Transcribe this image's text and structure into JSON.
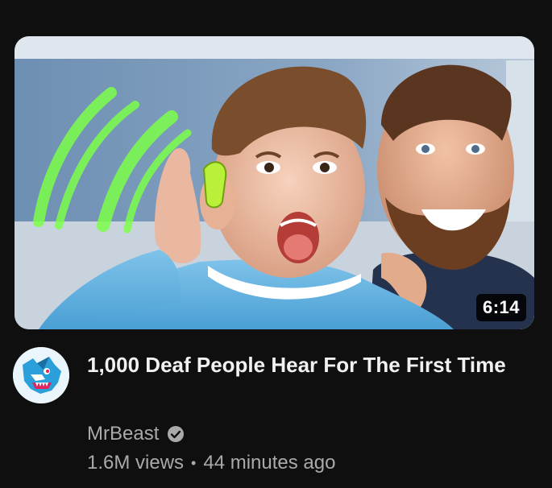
{
  "video": {
    "title": "1,000 Deaf People Hear For The First Time",
    "duration": "6:14",
    "views": "1.6M views",
    "separator": "•",
    "published": "44 minutes ago"
  },
  "channel": {
    "name": "MrBeast",
    "verified_icon": "verified-check-icon",
    "avatar_icon": "mrbeast-panther-logo"
  },
  "colors": {
    "background": "#0f0f0f",
    "title": "#f1f1f1",
    "secondary_text": "#aaaaaa",
    "avatar_blue": "#2b9fd9"
  }
}
